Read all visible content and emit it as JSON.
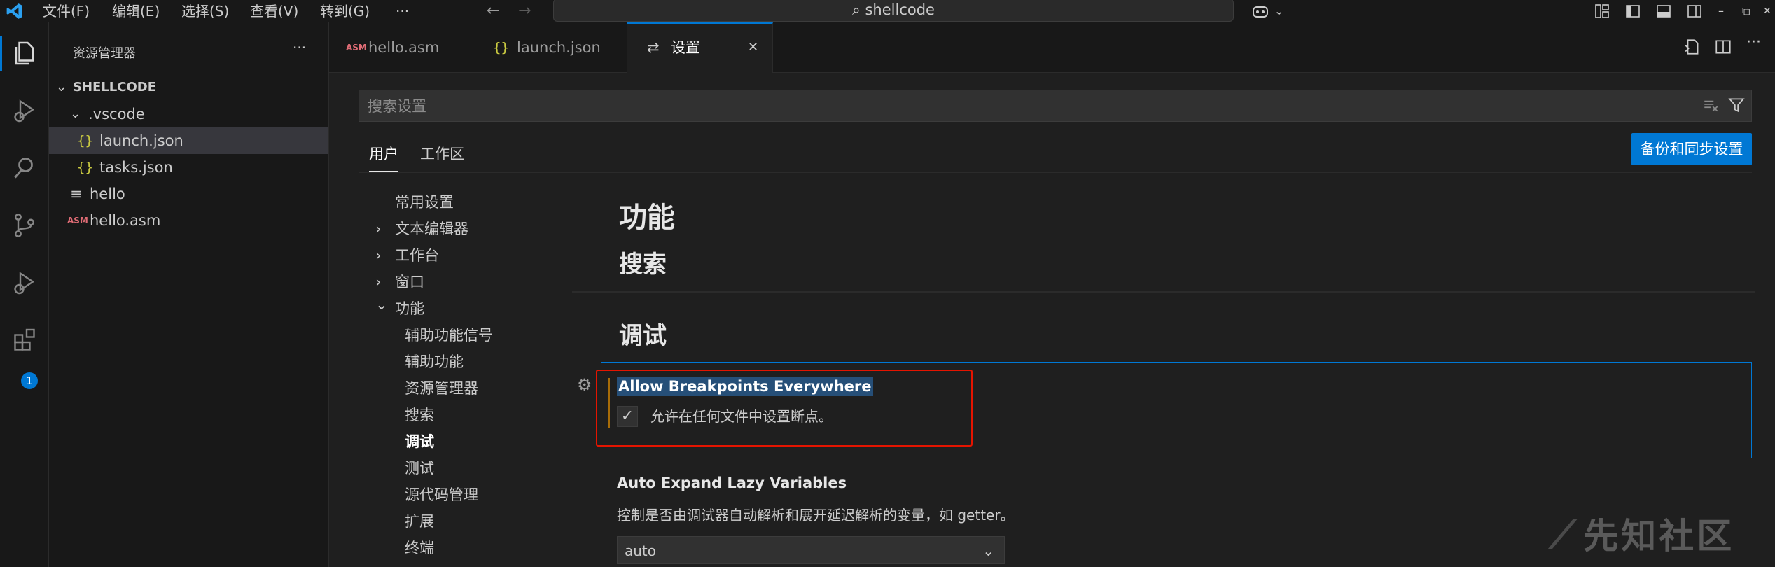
{
  "titlebar": {
    "menu": [
      "文件(F)",
      "编辑(E)",
      "选择(S)",
      "查看(V)",
      "转到(G)",
      "···"
    ],
    "command_center": "shellcode",
    "icons": [
      "vscode-logo-icon",
      "arrow-left-icon",
      "arrow-right-icon",
      "search-icon",
      "copilot-icon",
      "chevron-down-icon",
      "customize-layout-icon",
      "toggle-primary-sidebar-icon",
      "toggle-panel-icon",
      "toggle-secondary-sidebar-icon",
      "minimize-icon",
      "restore-icon",
      "close-icon"
    ]
  },
  "activitybar": {
    "icons": [
      "explorer-icon",
      "run-debug-icon",
      "search-icon",
      "source-control-icon",
      "run-debug-2-icon",
      "extensions-icon"
    ],
    "extensions_badge": "1"
  },
  "sidebar": {
    "title": "资源管理器",
    "more": "···",
    "tree": [
      {
        "label": "SHELLCODE",
        "chevron": "v",
        "icon": "",
        "kind": "root"
      },
      {
        "label": ".vscode",
        "chevron": "v",
        "icon": "",
        "kind": "folder"
      },
      {
        "label": "launch.json",
        "chevron": "",
        "icon": "{}",
        "kind": "json"
      },
      {
        "label": "tasks.json",
        "chevron": "",
        "icon": "{}",
        "kind": "json"
      },
      {
        "label": "hello",
        "chevron": "",
        "icon": "≡",
        "kind": "file"
      },
      {
        "label": "hello.asm",
        "chevron": "",
        "icon": "ASM",
        "kind": "asm"
      }
    ]
  },
  "tabs": [
    {
      "label": "hello.asm",
      "icon": "ASM"
    },
    {
      "label": "launch.json",
      "icon": "{}"
    },
    {
      "label": "设置",
      "icon": "⇄",
      "close": "✕"
    }
  ],
  "settings": {
    "search_placeholder": "搜索设置",
    "scope_tabs": [
      "用户",
      "工作区"
    ],
    "sync_button": "备份和同步设置",
    "toc": [
      {
        "label": "常用设置",
        "chevron": ""
      },
      {
        "label": "文本编辑器",
        "chevron": "›"
      },
      {
        "label": "工作台",
        "chevron": "›"
      },
      {
        "label": "窗口",
        "chevron": "›"
      },
      {
        "label": "功能",
        "chevron": "⌄"
      },
      {
        "label": "辅助功能信号",
        "chevron": ""
      },
      {
        "label": "辅助功能",
        "chevron": ""
      },
      {
        "label": "资源管理器",
        "chevron": ""
      },
      {
        "label": "搜索",
        "chevron": ""
      },
      {
        "label": "调试",
        "chevron": ""
      },
      {
        "label": "测试",
        "chevron": ""
      },
      {
        "label": "源代码管理",
        "chevron": ""
      },
      {
        "label": "扩展",
        "chevron": ""
      },
      {
        "label": "终端",
        "chevron": ""
      }
    ],
    "sections": {
      "features": "功能",
      "search": "搜索",
      "debug": "调试"
    },
    "setting1": {
      "title": "Allow Breakpoints Everywhere",
      "description": "允许在任何文件中设置断点。",
      "checked": "✓"
    },
    "setting2": {
      "title": "Auto Expand Lazy Variables",
      "description": "控制是否由调试器自动解析和展开延迟解析的变量，如 getter。",
      "value": "auto"
    }
  },
  "watermark": "先知社区"
}
